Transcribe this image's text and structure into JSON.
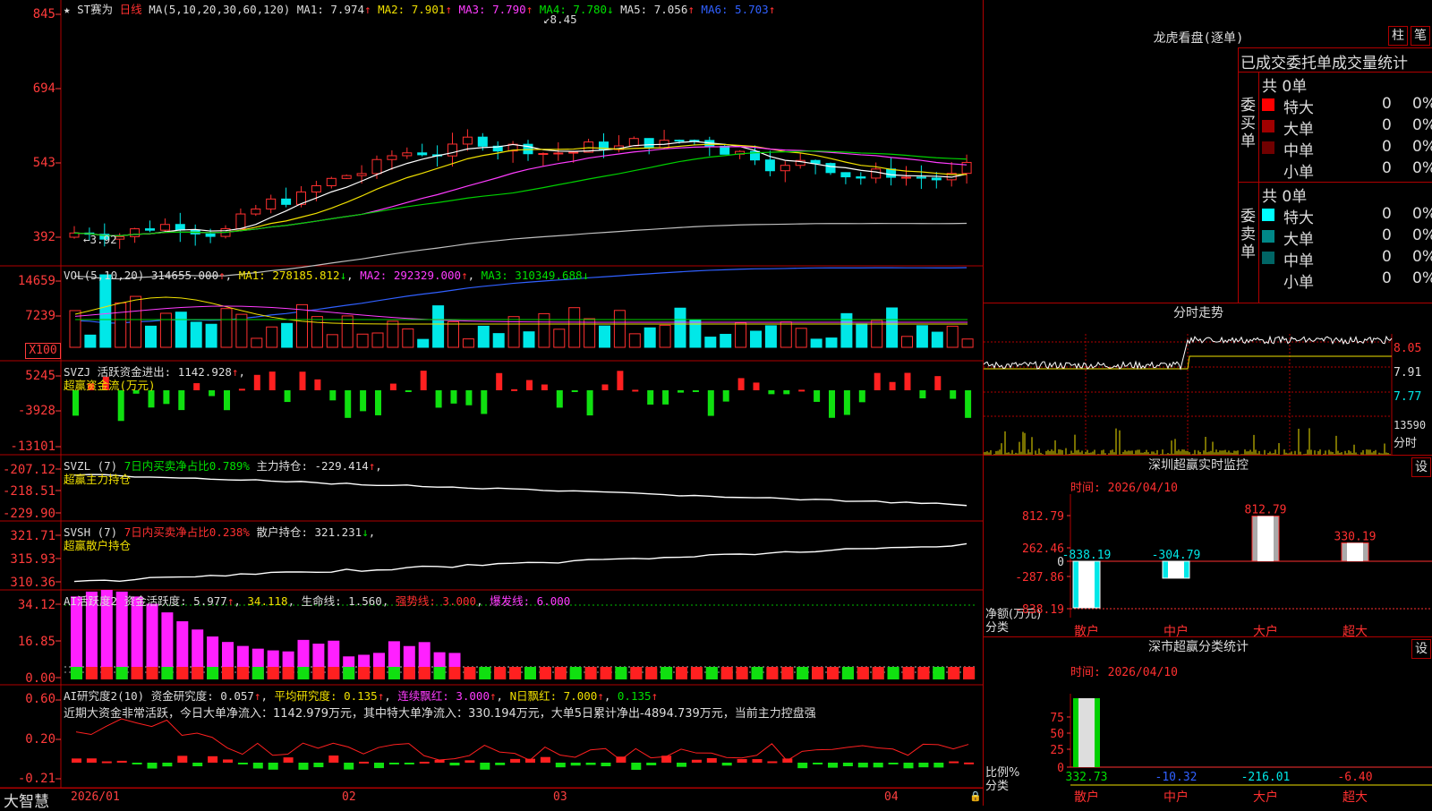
{
  "stock_name": "ST赛为",
  "candle_header": {
    "star": "★",
    "period": "日线",
    "ma_params": "MA(5,10,20,30,60,120)",
    "ma1": "MA1: 7.974",
    "ma2": "MA2: 7.901",
    "ma3": "MA3: 7.790",
    "ma4": "MA4: 7.780",
    "ma5": "MA5: 7.056",
    "ma6": "MA6: 5.703",
    "high_mark": "8.45",
    "low_mark": "3.92"
  },
  "price_axis": [
    "845",
    "694",
    "543",
    "392"
  ],
  "vol_header": {
    "name": "VOL(5,10,20)",
    "value": "314655.000",
    "ma1": "MA1: 278185.812",
    "ma2": "MA2: 292329.000",
    "ma3": "MA3: 310349.688"
  },
  "vol_axis": [
    "14659",
    "7239",
    "X100"
  ],
  "svzj_header": {
    "name": "SVZJ",
    "label": "活跃资金进出:",
    "value": "1142.928",
    "sub": "超赢资金流(万元)"
  },
  "svzj_axis": [
    "5245",
    "-3928",
    "-13101"
  ],
  "svzl_header": {
    "name": "SVZL (7)",
    "ratio": "7日内买卖净占比0.789%",
    "label": "主力持仓:",
    "value": "-229.414",
    "sub": "超赢主力持仓"
  },
  "svzl_axis": [
    "-207.12",
    "-218.51",
    "-229.90"
  ],
  "svsh_header": {
    "name": "SVSH (7)",
    "ratio": "7日内买卖净占比0.238%",
    "label": "散户持仓:",
    "value": "321.231",
    "sub": "超赢散户持仓"
  },
  "svsh_axis": [
    "321.71",
    "315.93",
    "310.36"
  ],
  "ai_active": {
    "name": "AI活跃度2",
    "label": "资金活跃度:",
    "value": "5.977",
    "v2": "34.118",
    "life": "生命线: 1.560",
    "strong": "强势线: 3.000",
    "burst": "爆发线: 6.000"
  },
  "ai_active_axis": [
    "34.12",
    "16.85",
    "0.00"
  ],
  "ai_research": {
    "name": "AI研究度2(10)",
    "label": "资金研究度:",
    "value": "0.057",
    "avg": "平均研究度: 0.135",
    "red": "连续飘红: 3.000",
    "nday": "N日飘红: 7.000",
    "v": "0.135",
    "comment": "近期大资金非常活跃，今日大单净流入：1142.979万元，其中特大单净流入：330.194万元，大单5日累计净出-4894.739万元，当前主力控盘强"
  },
  "ai_research_axis": [
    "0.60",
    "0.20",
    "-0.21"
  ],
  "date_axis": [
    "2026/01",
    "02",
    "03",
    "04"
  ],
  "brand": "大智慧",
  "right": {
    "dragon_title": "龙虎看盘(逐单)",
    "btn_bar": "柱",
    "btn_pen": "笔",
    "tabs": [
      "已成交",
      "委托单",
      "成交量统计"
    ],
    "buy": {
      "side": "委买单",
      "total": "共 0单",
      "rows": [
        {
          "name": "特大",
          "n": "0",
          "p": "0%",
          "color": "#ff0000"
        },
        {
          "name": "大单",
          "n": "0",
          "p": "0%",
          "color": "#a00000"
        },
        {
          "name": "中单",
          "n": "0",
          "p": "0%",
          "color": "#700000"
        },
        {
          "name": "小单",
          "n": "0",
          "p": "0%",
          "color": ""
        }
      ]
    },
    "sell": {
      "side": "委卖单",
      "total": "共 0单",
      "rows": [
        {
          "name": "特大",
          "n": "0",
          "p": "0%",
          "color": "#00ffff"
        },
        {
          "name": "大单",
          "n": "0",
          "p": "0%",
          "color": "#008888"
        },
        {
          "name": "中单",
          "n": "0",
          "p": "0%",
          "color": "#006666"
        },
        {
          "name": "小单",
          "n": "0",
          "p": "0%",
          "color": ""
        }
      ]
    },
    "intraday": {
      "title": "分时走势",
      "axis": [
        "8.05",
        "7.91",
        "7.77",
        "13590",
        "分时"
      ]
    },
    "monitor": {
      "title": "深圳超赢实时监控",
      "time": "时间: 2026/04/10",
      "btn": "设",
      "axis": [
        "812.79",
        "262.46",
        "0",
        "-287.86",
        "-838.19"
      ],
      "netlabel": "净额(万元)",
      "catlabel": "分类",
      "cats": [
        "散户",
        "中户",
        "大户",
        "超大"
      ],
      "values": [
        -838.19,
        -304.79,
        812.79,
        330.19
      ],
      "labels": [
        "-838.19",
        "-304.79",
        "812.79",
        "330.19"
      ]
    },
    "stats": {
      "title": "深市超赢分类统计",
      "time": "时间: 2026/04/10",
      "btn": "设",
      "axis": [
        "75",
        "50",
        "25",
        "0"
      ],
      "ratiolabel": "比例%",
      "catlabel": "分类",
      "cats": [
        "散户",
        "中户",
        "大户",
        "超大"
      ],
      "values": [
        "332.73",
        "-10.32",
        "-216.01",
        "-6.40"
      ]
    }
  }
}
